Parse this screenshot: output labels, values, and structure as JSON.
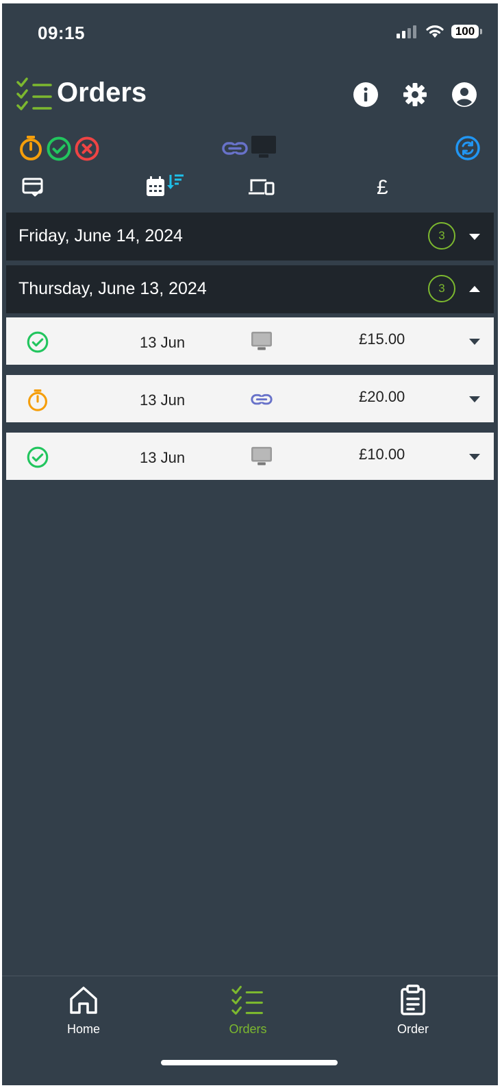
{
  "status_bar": {
    "time": "09:15",
    "battery": "100"
  },
  "header": {
    "title": "Orders",
    "icons": [
      "info-icon",
      "settings-icon",
      "account-icon"
    ]
  },
  "filters": {
    "status": [
      "pending-timer-icon",
      "completed-check-icon",
      "cancelled-x-icon"
    ],
    "channel": [
      "link-icon",
      "monitor-icon"
    ],
    "refresh": "refresh-icon"
  },
  "columns": [
    "card-check-icon",
    "calendar-sort-icon",
    "devices-icon",
    "£"
  ],
  "colors": {
    "background": "#333f4a",
    "group_header": "#1f252b",
    "row": "#f4f4f4",
    "accent_green": "#7cb82f",
    "status_green": "#22c55e",
    "status_orange": "#f59e0b",
    "status_red": "#ef4444",
    "link_blue": "#6872c9",
    "refresh_blue": "#2196f3"
  },
  "groups": [
    {
      "label": "Friday, June 14, 2024",
      "count": "3",
      "expanded": false,
      "orders": []
    },
    {
      "label": "Thursday, June 13, 2024",
      "count": "3",
      "expanded": true,
      "orders": [
        {
          "status": "completed",
          "date": "13 Jun",
          "channel": "monitor",
          "amount": "£15.00"
        },
        {
          "status": "pending",
          "date": "13 Jun",
          "channel": "link",
          "amount": "£20.00"
        },
        {
          "status": "completed",
          "date": "13 Jun",
          "channel": "monitor",
          "amount": "£10.00"
        }
      ]
    }
  ],
  "tab_bar": {
    "tabs": [
      {
        "label": "Home",
        "icon": "home-icon",
        "active": false
      },
      {
        "label": "Orders",
        "icon": "orders-checklist-icon",
        "active": true
      },
      {
        "label": "Order",
        "icon": "clipboard-icon",
        "active": false
      }
    ]
  }
}
